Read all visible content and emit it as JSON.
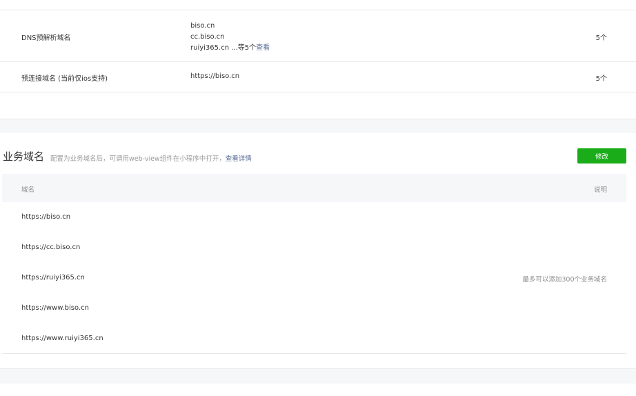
{
  "server_domains": {
    "dns_row": {
      "name": "DNS预解析域名",
      "values": [
        "biso.cn",
        "cc.biso.cn",
        "ruiyi365.cn"
      ],
      "more_suffix": "...等5个",
      "view_link": "查看",
      "count": "5个"
    },
    "preconnect_row": {
      "name": "预连接域名 (当前仅ios支持)",
      "value": "https://biso.cn",
      "count": "5个"
    }
  },
  "business_domains": {
    "title": "业务域名",
    "description": "配置为业务域名后，可调用web-view组件在小程序中打开，",
    "details_link": "查看详情",
    "modify_button": "修改",
    "columns": {
      "domain": "域名",
      "note": "说明"
    },
    "rows": [
      "https://biso.cn",
      "https://cc.biso.cn",
      "https://ruiyi365.cn",
      "https://www.biso.cn",
      "https://www.ruiyi365.cn"
    ],
    "note_text": "最多可以添加300个业务域名"
  },
  "colors": {
    "primary_green": "#1aad19",
    "link_blue": "#576b95",
    "muted_text": "#9a9a9a"
  }
}
